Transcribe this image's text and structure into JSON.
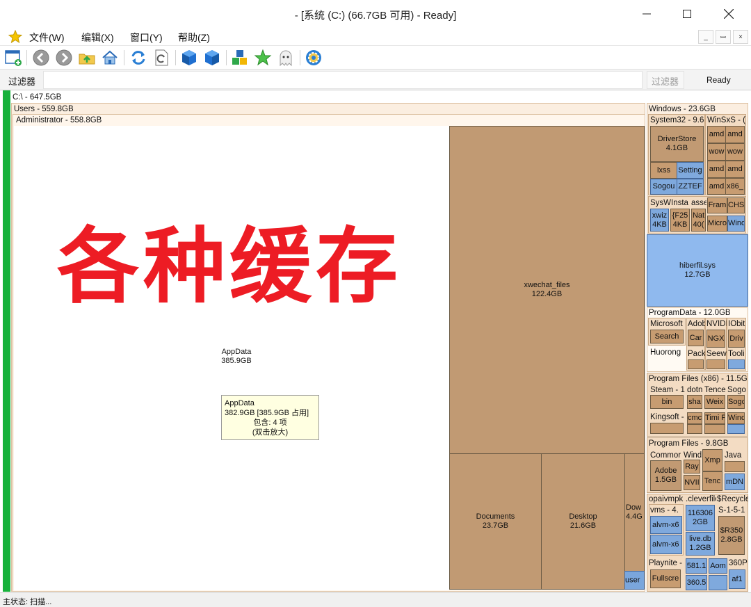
{
  "window": {
    "title": "- [系统 (C:) (66.7GB 可用) - Ready]"
  },
  "menu": {
    "items": [
      "文件(W)",
      "编辑(X)",
      "窗口(Y)",
      "帮助(Z)"
    ],
    "mdi": [
      "_",
      "ꟷ",
      "×"
    ]
  },
  "toolbar": {
    "icons": [
      "new-window-icon",
      "back-icon",
      "forward-icon",
      "up-folder-icon",
      "home-icon",
      "refresh-icon",
      "refresh-file-icon",
      "blue-cube-icon",
      "blue-cube-2-icon",
      "colored-blocks-icon",
      "star-icon",
      "ghost-icon",
      "gear-icon"
    ]
  },
  "filter": {
    "label": "过滤器",
    "value": "",
    "right_label": "过滤器",
    "status": "Ready"
  },
  "tree": {
    "root": "C:\\ - 647.5GB",
    "users": "Users - 559.8GB",
    "administrator": "Administrator - 558.8GB",
    "appdata_name": "AppData",
    "appdata_size": "385.9GB",
    "xwechat_name": "xwechat_files",
    "xwechat_size": "122.4GB",
    "documents_name": "Documents",
    "documents_size": "23.7GB",
    "desktop_name": "Desktop",
    "desktop_size": "21.6GB",
    "downloads_name": "Dow",
    "downloads_size": "4.4G",
    "user_small": "user",
    "windows": "Windows - 23.6GB",
    "system32": "System32 - 9.6",
    "winsxs": "WinSxS - (",
    "driverstore_name": "DriverStore",
    "driverstore_size": "4.1GB",
    "lxss": "lxss",
    "setting": "Setting",
    "sogou": "Sogou",
    "zztef": "ZZTEF",
    "amd1": "amd",
    "amd2": "amd",
    "wow1": "wow",
    "wow2": "wow",
    "amd3": "amd",
    "amd4": "amd",
    "amd5": "amd",
    "x86": "x86_",
    "sysw": "SysW",
    "insta": "Insta",
    "asse": "asse",
    "fram": "Fram",
    "chs": "CHS",
    "xwiz": "xwiz",
    "xwiz_size": "4KB",
    "f25": "{F25",
    "f25_size": "4KB",
    "nat": "Nat",
    "nat_size": "40(",
    "micro": "Micro",
    "wind_small": "Wind",
    "hiberfil_name": "hiberfil.sys",
    "hiberfil_size": "12.7GB",
    "programdata": "ProgramData - 12.0GB",
    "pd_microsoft": "Microsoft",
    "pd_adob": "Adob",
    "pd_nvidi": "NVIDI",
    "pd_iobit": "IObit",
    "pd_search": "Search",
    "pd_car": "Car",
    "pd_ngx": "NGX",
    "pd_driv": "Driv",
    "pd_huorong": "Huorong",
    "pd_pack": "Pack",
    "pd_seew": "Seew",
    "pd_tooli": "Tooli",
    "pf86": "Program Files (x86) - 11.5G",
    "pf86_steam": "Steam - 1",
    "pf86_dotn": "dotn",
    "pf86_tence": "Tence",
    "pf86_sogo": "Sogo",
    "pf86_bin": "bin",
    "pf86_sha": "sha",
    "pf86_weix": "Weix",
    "pf86_sogo2": "Sogo",
    "pf86_kingsoft": "Kingsoft -",
    "pf86_cmc": "cmc",
    "pf86_timi": "Timi P",
    "pf86_wind": "Wind",
    "pf": "Program Files - 9.8GB",
    "pf_common": "Commor",
    "pf_wind": "Wind",
    "pf_xmp": "Xmp",
    "pf_java": "Java",
    "pf_adobe": "Adobe",
    "pf_adobe_size": "1.5GB",
    "pf_ray": "Ray",
    "pf_nvii": "NVII",
    "pf_tenc": "Tenc",
    "pf_mdn": "mDN",
    "opaivmpk": "opaivmpk",
    "cleverfil": ".cleverfile",
    "recycle": "$Recycle",
    "vms": "vms - 4.",
    "alvm1": "alvm-x6",
    "alvm2": "alvm-x6",
    "f116306": "116306",
    "f116306_size": "2GB",
    "livedb": "live.db",
    "livedb_size": "1.2GB",
    "s151": "S-1-5-1",
    "r350": "$R350",
    "r350_size": "2.8GB",
    "playnite": "Playnite -",
    "f5811": "581.1",
    "aom": "Aom",
    "f3605": "360.5",
    "f360p": "360P",
    "af1": "af1",
    "fullscre": "Fullscre"
  },
  "overlay_text": "各种缓存",
  "tooltip": {
    "name": "AppData",
    "size": "382.9GB [385.9GB 占用]",
    "contains": "包含: 4 项",
    "hint": "(双击放大)"
  },
  "status": {
    "text": "主状态: 扫描..."
  }
}
